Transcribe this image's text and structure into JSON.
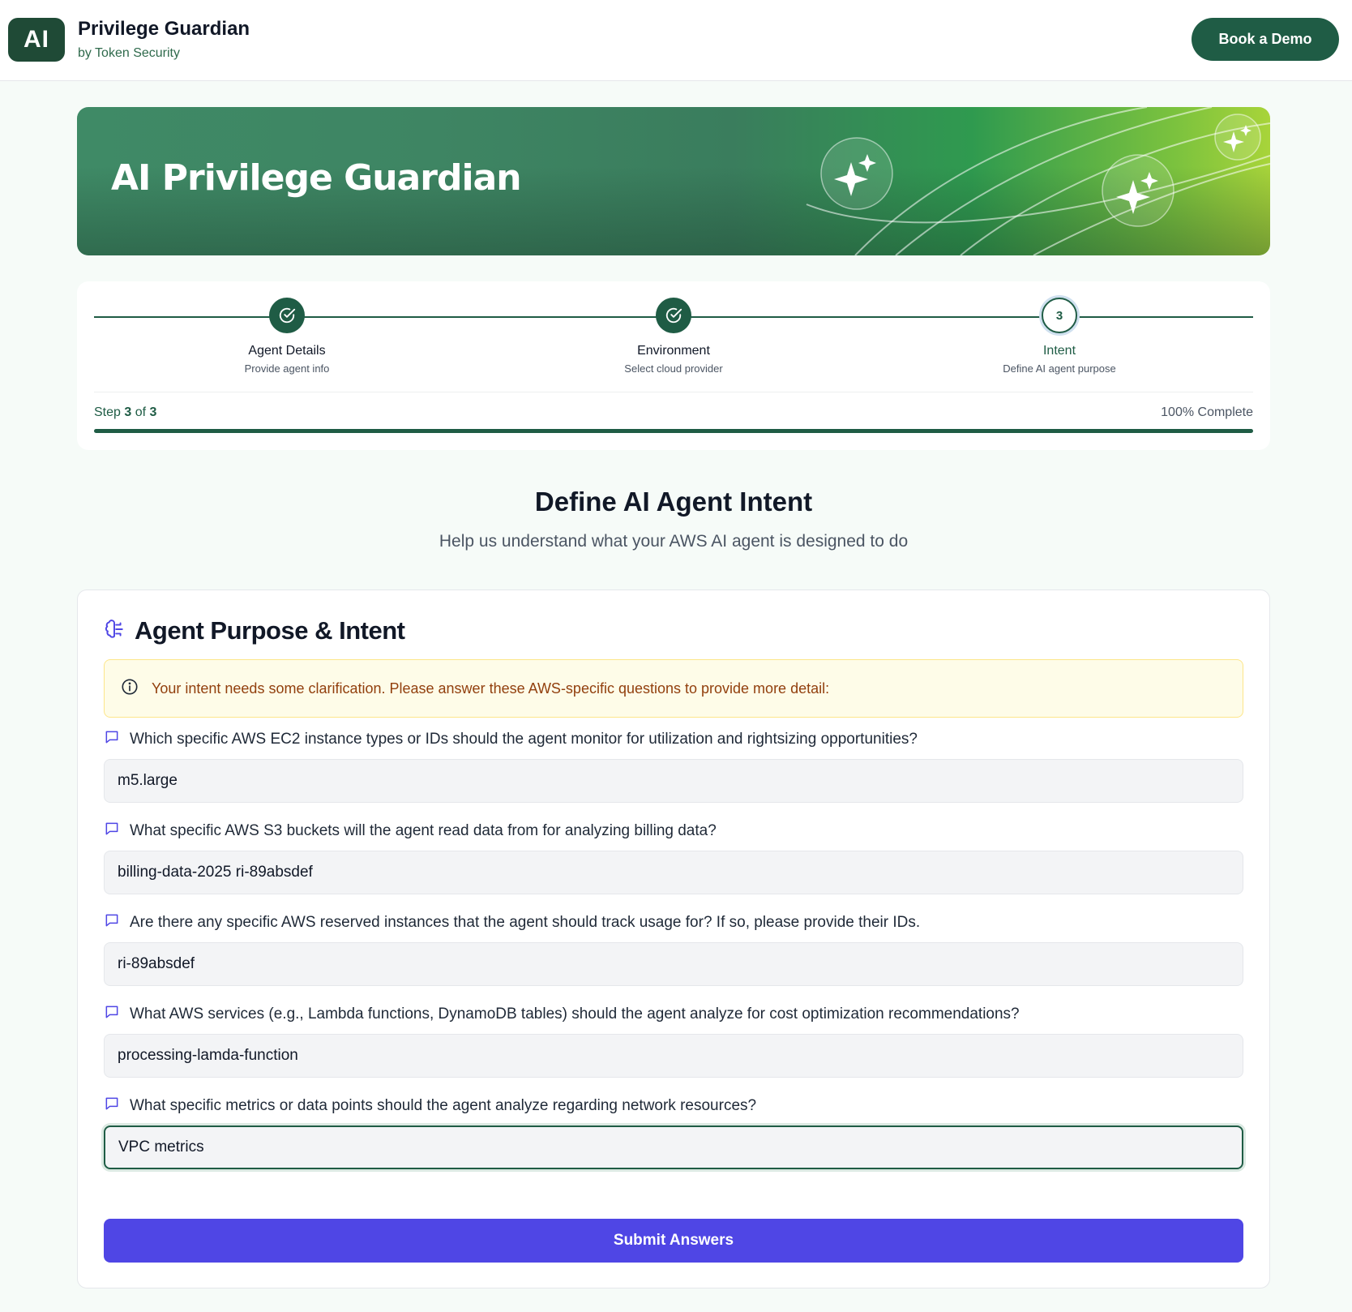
{
  "header": {
    "logo_text": "AI",
    "brand_title": "Privilege Guardian",
    "brand_sub": "by Token Security",
    "demo_label": "Book a Demo"
  },
  "hero": {
    "title": "AI Privilege Guardian"
  },
  "stepper": {
    "steps": [
      {
        "label": "Agent Details",
        "desc": "Provide agent info",
        "state": "done"
      },
      {
        "label": "Environment",
        "desc": "Select cloud provider",
        "state": "done"
      },
      {
        "label": "Intent",
        "desc": "Define AI agent purpose",
        "state": "current",
        "number": "3"
      }
    ],
    "step_prefix": "Step",
    "step_current": "3",
    "step_of": "of",
    "step_total": "3",
    "percent_label": "100% Complete",
    "progress": 1.0
  },
  "section": {
    "title": "Define AI Agent Intent",
    "subtitle": "Help us understand what your AWS AI agent is designed to do"
  },
  "card": {
    "title": "Agent Purpose & Intent",
    "notice": "Your intent needs some clarification. Please answer these AWS-specific questions to provide more detail:",
    "questions": [
      {
        "label": "Which specific AWS EC2 instance types or IDs should the agent monitor for utilization and rightsizing opportunities?",
        "value": "m5.large"
      },
      {
        "label": "What specific AWS S3 buckets will the agent read data from for analyzing billing data?",
        "value": "billing-data-2025 ri-89absdef"
      },
      {
        "label": "Are there any specific AWS reserved instances that the agent should track usage for? If so, please provide their IDs.",
        "value": "ri-89absdef"
      },
      {
        "label": "What AWS services (e.g., Lambda functions, DynamoDB tables) should the agent analyze for cost optimization recommendations?",
        "value": "processing-lamda-function"
      },
      {
        "label": "What specific metrics or data points should the agent analyze regarding network resources?",
        "value": "VPC metrics"
      }
    ],
    "submit_label": "Submit Answers"
  },
  "colors": {
    "brand_green": "#1f5c45",
    "accent_indigo": "#4f46e5",
    "notice_bg": "#fefce8",
    "notice_text": "#92400e"
  },
  "icons": {
    "step_done": "check-circle-icon",
    "card_head": "brain-icon",
    "notice": "info-icon",
    "question": "chat-bubble-icon"
  }
}
